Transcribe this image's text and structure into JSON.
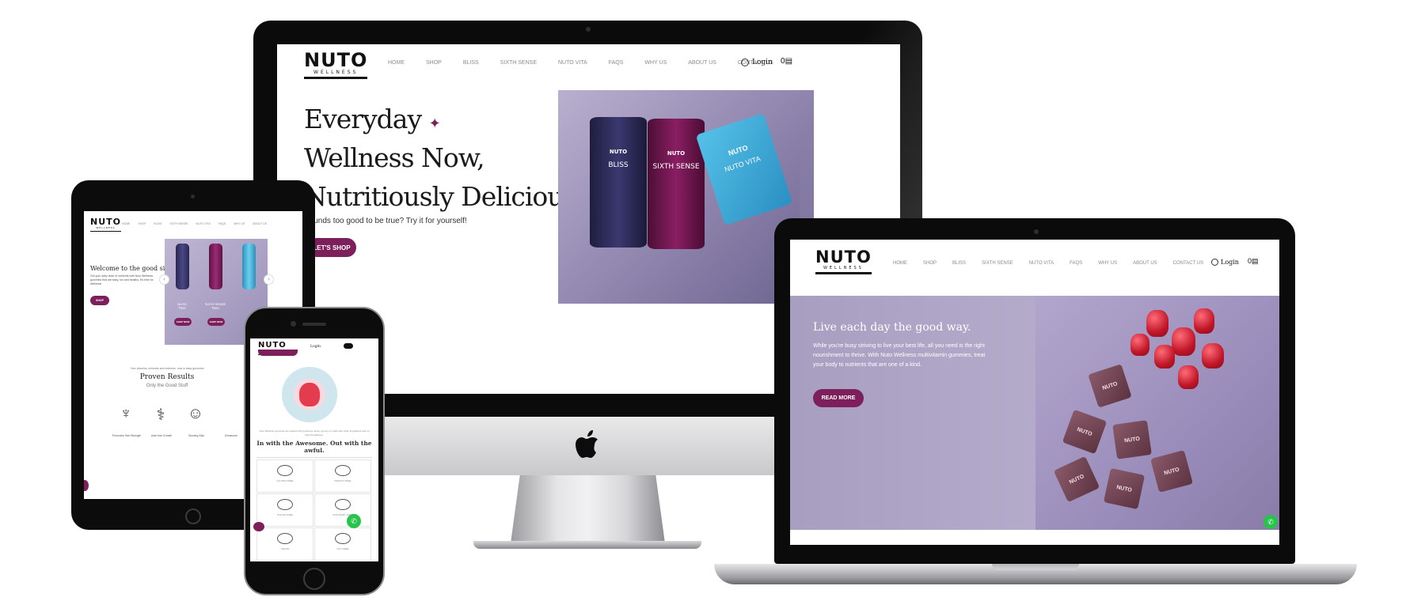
{
  "brand": {
    "name": "NUTO",
    "tagline": "WELLNESS",
    "accent": "#7d1f5a",
    "whatsapp_green": "#27c44b"
  },
  "nav": {
    "items": [
      "HOME",
      "SHOP",
      "BLISS",
      "SIXTH SENSE",
      "NUTO VITA",
      "FAQs",
      "WHY US",
      "ABOUT US",
      "CONTACT US"
    ],
    "login": "Login",
    "cart_count": "0"
  },
  "desktop": {
    "heading_line1": "Everyday",
    "heading_line2": "Wellness Now,",
    "heading_line3": "Nutritiously Delicious",
    "star": "✦",
    "subtitle": "Sounds too good to be true? Try it for yourself!",
    "cta": "LET'S SHOP",
    "products": [
      {
        "brand": "NUTO",
        "name": "BLISS"
      },
      {
        "brand": "NUTO",
        "name": "SIXTH SENSE"
      },
      {
        "brand": "NUTO",
        "name": "NUTO VITA"
      }
    ]
  },
  "tablet": {
    "heading": "Welcome to the good side",
    "body": "Get your daily dose of nutrients with Nuto Wellness gummies that are tasty, fun and healthy. It's time for wellness!",
    "cta": "SHOP",
    "product_labels": [
      "BLISS",
      "SIXTH SENSE"
    ],
    "product_prices": [
      "₹999",
      "₹899"
    ],
    "shop_now": "SHOP NOW",
    "intro": "Your vitamins, minerals and nutrients, now in tasty gummies",
    "section_title": "Proven Results",
    "section_sub": "Only the Good Stuff",
    "features": [
      "Promotes Hair Strength",
      "Aids Hair Growth",
      "Glowing Skin",
      "Enhances"
    ]
  },
  "phone": {
    "login": "Login",
    "body": "Nuto Wellness gummies are packed with goodness. Every gummy is made with clean ingredients and no harmful additives.",
    "heading": "In with the Awesome. Out with the awful.",
    "grid": [
      "GLUTEN FREE",
      "PEANUT FREE",
      "SUGAR FREE",
      "NON-DAIRY FREE",
      "VEGAN",
      "SOY FREE"
    ]
  },
  "laptop": {
    "heading": "Live each day the good way.",
    "body": "While you're busy striving to live your best life, all you need is the right nourishment to thrive. With Nuto Wellness multivitamin gummies, treat your body to nutrients that are one of a kind.",
    "cta": "READ MORE",
    "wrapper_text": "NUTO"
  }
}
